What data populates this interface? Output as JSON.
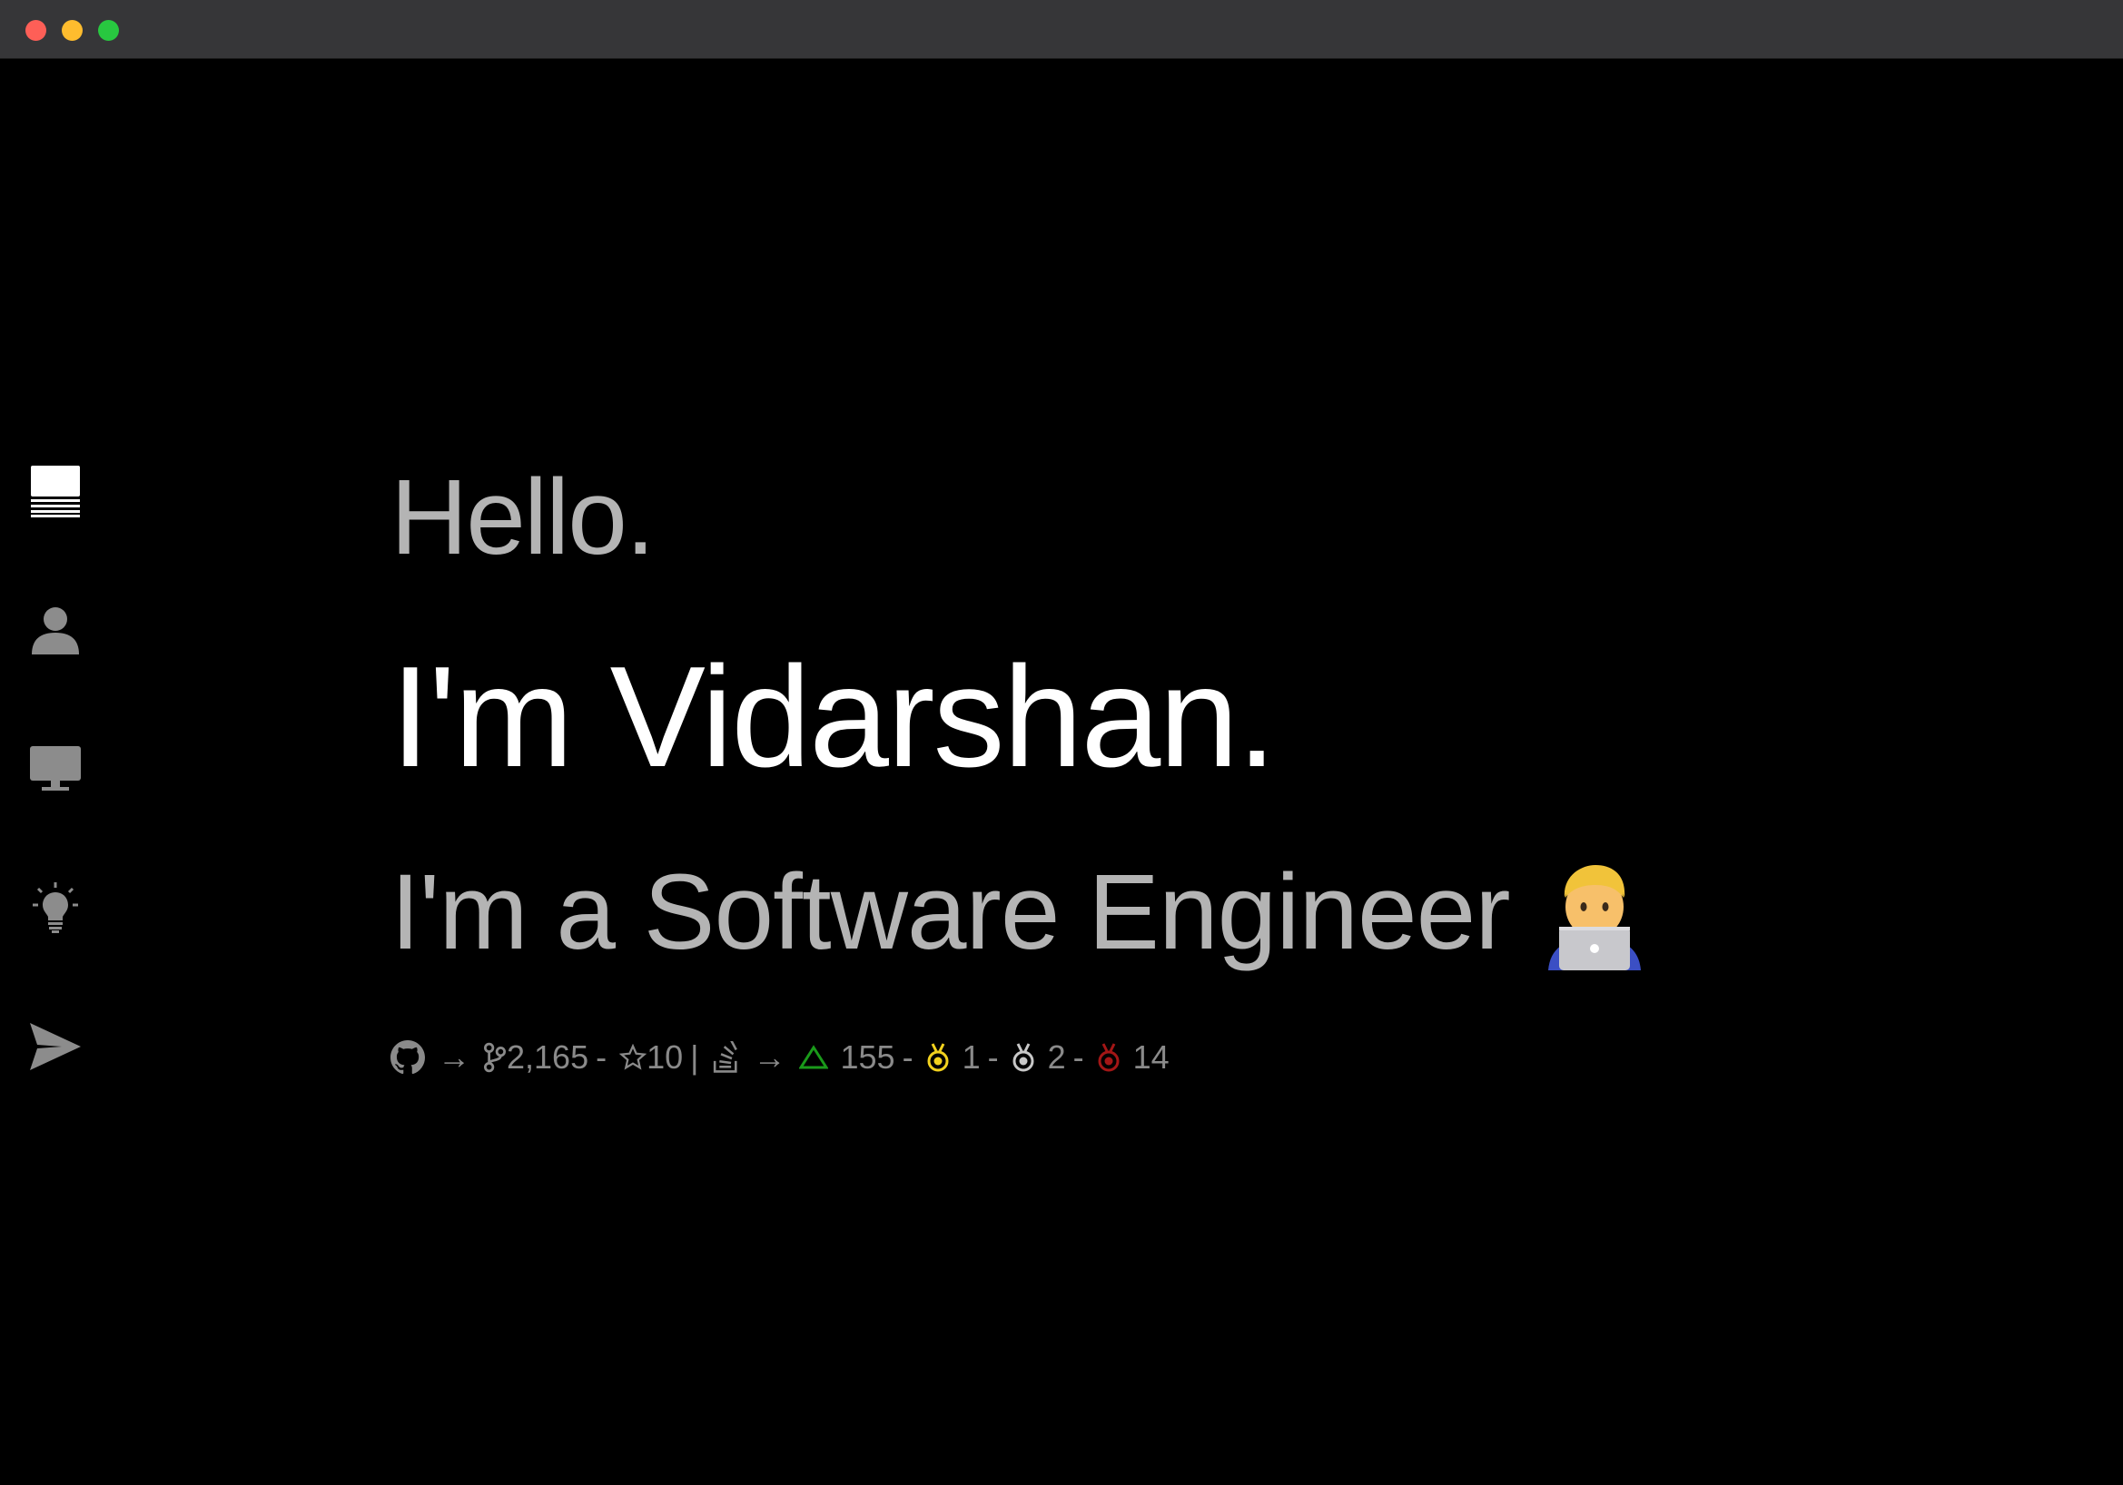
{
  "window": {
    "traffic_lights": {
      "close": "#fe5f57",
      "minimize": "#febc2e",
      "maximize": "#28c840"
    }
  },
  "sidebar": {
    "items": [
      {
        "icon": "home-screen-icon",
        "active": true
      },
      {
        "icon": "person-icon",
        "active": false
      },
      {
        "icon": "monitor-icon",
        "active": false
      },
      {
        "icon": "lightbulb-icon",
        "active": false
      },
      {
        "icon": "paper-plane-icon",
        "active": false
      }
    ]
  },
  "hero": {
    "greeting": "Hello.",
    "name": "I'm Vidarshan.",
    "role": "I'm a Software Engineer",
    "role_emoji": "man-technologist-emoji"
  },
  "stats": {
    "github": {
      "icon": "github-icon",
      "arrow": "→",
      "commits_icon": "git-branch-icon",
      "commits": "2,165",
      "dash1": "-",
      "stars_icon": "star-icon",
      "stars": "10"
    },
    "divider": "|",
    "stackoverflow": {
      "icon": "stackoverflow-icon",
      "arrow": "→",
      "reputation_icon": "triangle-up-icon",
      "reputation": "155",
      "dash1": "-",
      "gold_icon": "gold-badge-icon",
      "gold": "1",
      "dash2": "-",
      "silver_icon": "silver-badge-icon",
      "silver": "2",
      "dash3": "-",
      "bronze_icon": "bronze-badge-icon",
      "bronze": "14"
    },
    "colors": {
      "text": "#8a8a8a",
      "reputation": "#1a9a1a",
      "gold": "#f2d21e",
      "silver": "#c8c8c8",
      "bronze": "#a31616"
    }
  }
}
